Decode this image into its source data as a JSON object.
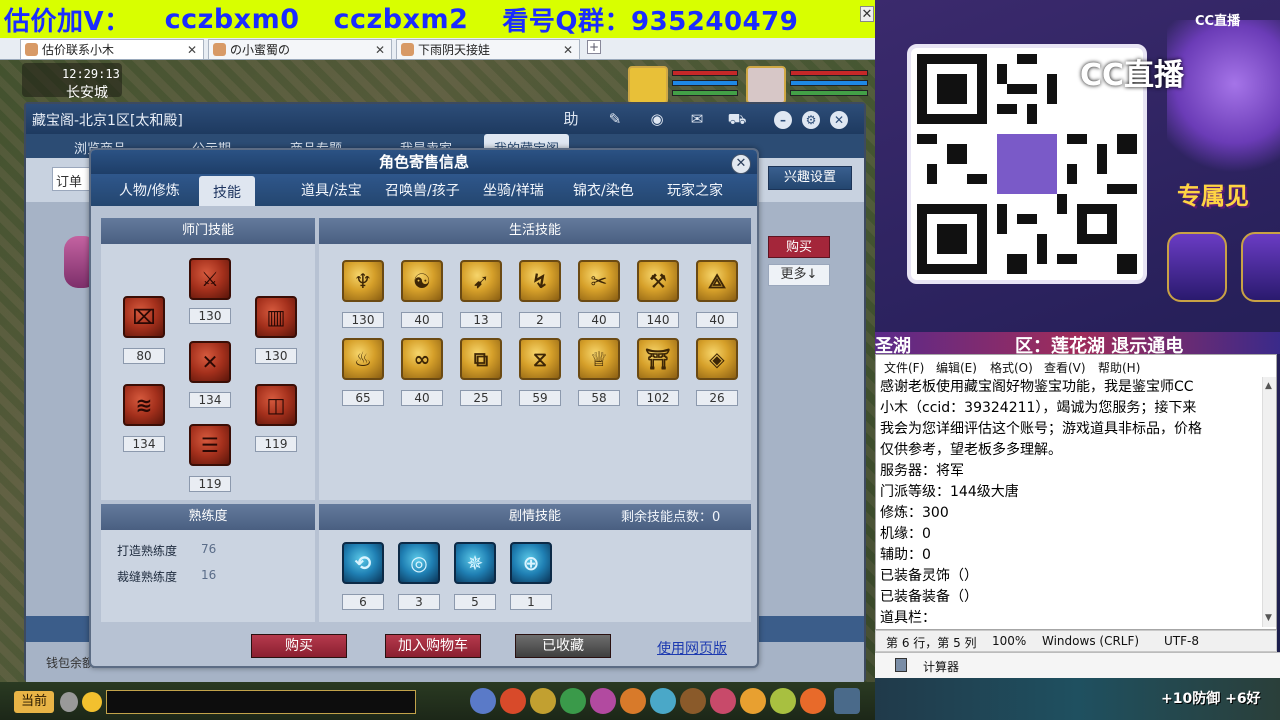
{
  "banner": {
    "part1": "估价加V：",
    "part2": "cczbxm0",
    "part3": "cczbxm2",
    "part4": "看号Q群：935240479"
  },
  "browser_tabs": [
    {
      "label": "估价联系小木"
    },
    {
      "label": "の小蜜蜀の"
    },
    {
      "label": "下雨阴天接娃"
    }
  ],
  "game": {
    "clock": "12:29:13",
    "location": "长安城"
  },
  "cbg": {
    "title": "藏宝阁-北京1区[太和殿]",
    "help": "助",
    "nav": [
      "浏览商品",
      "公示期",
      "商品专题",
      "我是卖家",
      "我的藏宝阁"
    ],
    "order": "订单",
    "hobby_btn": "兴趣设置",
    "buy_btn": "购买",
    "more_btn": "更多↓",
    "wallet": "钱包余额"
  },
  "popup": {
    "title": "角色寄售信息",
    "tabs": [
      "人物/修炼",
      "技能",
      "道具/法宝",
      "召唤兽/孩子",
      "坐骑/祥瑞",
      "锦衣/染色",
      "玩家之家"
    ],
    "active_tab": "技能",
    "sections": {
      "school": "师门技能",
      "life": "生活技能",
      "prof": "熟练度",
      "story": "剧情技能"
    },
    "school_skills": [
      "80",
      "130",
      "134",
      "119",
      "130",
      "134",
      "119"
    ],
    "life_skills_row1": [
      "130",
      "40",
      "13",
      "2",
      "40",
      "140",
      "40"
    ],
    "life_skills_row2": [
      "65",
      "40",
      "25",
      "59",
      "58",
      "102",
      "26"
    ],
    "story_skills": [
      "6",
      "3",
      "5",
      "1"
    ],
    "proficiency": [
      {
        "label": "打造熟练度",
        "value": "76"
      },
      {
        "label": "裁缝熟练度",
        "value": "16"
      }
    ],
    "remaining_label": "剩余技能点数：",
    "remaining_value": "0",
    "buttons": {
      "buy": "购买",
      "cart": "加入购物车",
      "fav": "已收藏",
      "web": "使用网页版"
    }
  },
  "right_panel": {
    "cc_logo": "CC直播",
    "cc_big": "CC直播",
    "promo": "专属见",
    "strip_a": "圣湖",
    "strip_b": "区：莲花湖 退示通电"
  },
  "notepad": {
    "menu": [
      "文件(F)",
      "编辑(E)",
      "格式(O)",
      "查看(V)",
      "帮助(H)"
    ],
    "lines": [
      "感谢老板使用藏宝阁好物鉴宝功能，我是鉴宝师CC",
      "小木（ccid：39324211），竭诚为您服务；接下来",
      "我会为您详细评估这个账号；游戏道具非标品，价格",
      "仅供参考，望老板多多理解。",
      "服务器：将军",
      "门派等级：144级大唐",
      "修炼：300",
      "机缘：0",
      "辅助：0",
      "已装备灵饰（）",
      "已装备装备（）",
      "道具栏："
    ],
    "status": {
      "pos": "第 6 行，第 5 列",
      "zoom": "100%",
      "eol": "Windows (CRLF)",
      "enc": "UTF-8"
    },
    "taskbar": "计算器"
  },
  "game_bottom": {
    "now": "当前",
    "right_text": "+10防御 +6好"
  }
}
